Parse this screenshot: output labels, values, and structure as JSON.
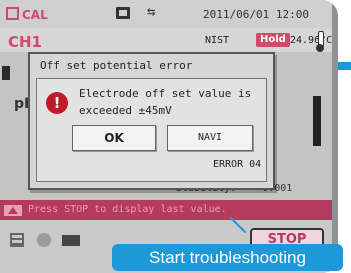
{
  "statusbar": {
    "cal_label": "CAL",
    "date_time": "2011/06/01 12:00",
    "icons": [
      "memory-card-icon",
      "usb-icon"
    ]
  },
  "channel": {
    "label": "CH1",
    "standard": "NIST",
    "hold_badge": "Hold",
    "temperature": "24.96°C",
    "icons": [
      "thermometer-icon"
    ]
  },
  "main": {
    "param_label": "pH",
    "stability_label": "Stability:",
    "stability_value": "0.001"
  },
  "dialog": {
    "title": "Off set potential error",
    "message_line1": "Electrode off set value is",
    "message_line2": "exceeded ±45mV",
    "ok_label": "OK",
    "navi_label": "NAVI",
    "error_code": "ERROR 04",
    "icon": "alert-icon"
  },
  "message_bar": {
    "text": "Press STOP to display last  value."
  },
  "bottom": {
    "stop_label": "STOP",
    "icons": [
      "data-list-icon",
      "circle-icon",
      "books-icon"
    ]
  },
  "callout": {
    "text": "Start troubleshooting"
  },
  "colors": {
    "accent_pink": "#b53a5d",
    "callout_blue": "#1f98d8",
    "screen_gray": "#c4c4c4"
  }
}
